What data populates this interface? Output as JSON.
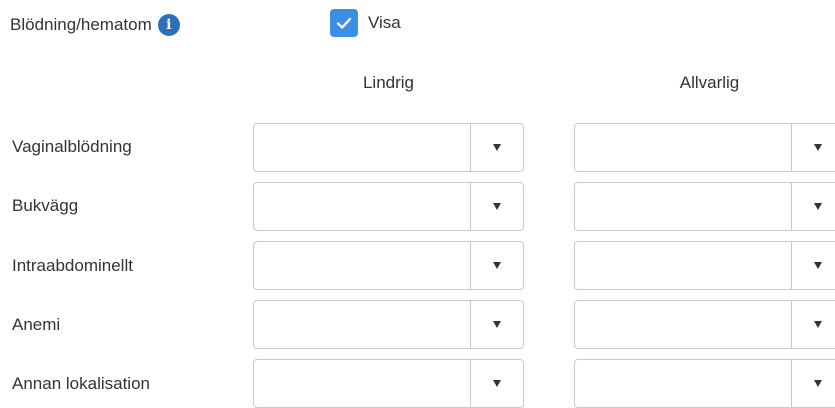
{
  "section": {
    "label": "Blödning/hematom",
    "info_icon": "info-icon"
  },
  "visa": {
    "label": "Visa",
    "checked": true
  },
  "columns": {
    "lindrig": "Lindrig",
    "allvarlig": "Allvarlig"
  },
  "rows": [
    {
      "label": "Vaginalblödning",
      "lindrig": "",
      "allvarlig": ""
    },
    {
      "label": "Bukvägg",
      "lindrig": "",
      "allvarlig": ""
    },
    {
      "label": "Intraabdominellt",
      "lindrig": "",
      "allvarlig": ""
    },
    {
      "label": "Anemi",
      "lindrig": "",
      "allvarlig": ""
    },
    {
      "label": "Annan lokalisation",
      "lindrig": "",
      "allvarlig": ""
    }
  ],
  "colors": {
    "accent": "#3a8ee6",
    "info": "#2f6fb8"
  }
}
